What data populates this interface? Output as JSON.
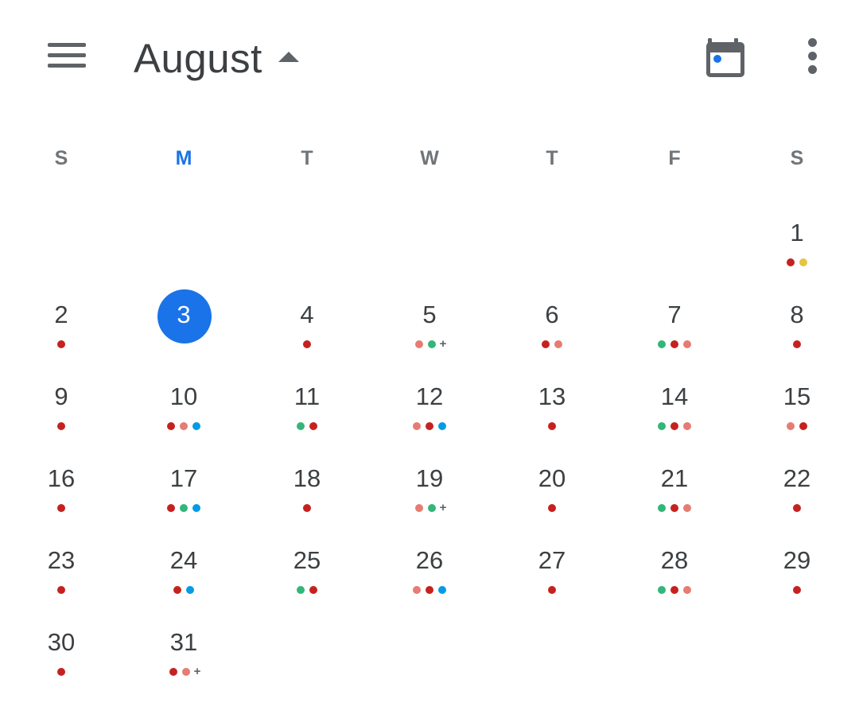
{
  "header": {
    "menu_icon": "hamburger-menu-icon",
    "month_title": "August",
    "toggle_icon": "caret-up-icon",
    "today_icon": "calendar-today-icon",
    "more_icon": "more-vert-icon"
  },
  "weekdays": [
    "S",
    "M",
    "T",
    "W",
    "T",
    "F",
    "S"
  ],
  "today": 3,
  "colors": {
    "red": "#c5221f",
    "salmon": "#e67c73",
    "green": "#33b679",
    "blue": "#039be5",
    "yellow": "#e4c441",
    "today_accent": "#1a73e8"
  },
  "days": [
    {
      "num": "1",
      "dots": [
        "red",
        "yellow"
      ]
    },
    {
      "num": "2",
      "dots": [
        "red"
      ]
    },
    {
      "num": "3",
      "dots": []
    },
    {
      "num": "4",
      "dots": [
        "red"
      ]
    },
    {
      "num": "5",
      "dots": [
        "salmon",
        "green"
      ],
      "plus": "+"
    },
    {
      "num": "6",
      "dots": [
        "red",
        "salmon"
      ]
    },
    {
      "num": "7",
      "dots": [
        "green",
        "red",
        "salmon"
      ]
    },
    {
      "num": "8",
      "dots": [
        "red"
      ]
    },
    {
      "num": "9",
      "dots": [
        "red"
      ]
    },
    {
      "num": "10",
      "dots": [
        "red",
        "salmon",
        "blue"
      ]
    },
    {
      "num": "11",
      "dots": [
        "green",
        "red"
      ]
    },
    {
      "num": "12",
      "dots": [
        "salmon",
        "red",
        "blue"
      ]
    },
    {
      "num": "13",
      "dots": [
        "red"
      ]
    },
    {
      "num": "14",
      "dots": [
        "green",
        "red",
        "salmon"
      ]
    },
    {
      "num": "15",
      "dots": [
        "salmon",
        "red"
      ]
    },
    {
      "num": "16",
      "dots": [
        "red"
      ]
    },
    {
      "num": "17",
      "dots": [
        "red",
        "green",
        "blue"
      ]
    },
    {
      "num": "18",
      "dots": [
        "red"
      ]
    },
    {
      "num": "19",
      "dots": [
        "salmon",
        "green"
      ],
      "plus": "+"
    },
    {
      "num": "20",
      "dots": [
        "red"
      ]
    },
    {
      "num": "21",
      "dots": [
        "green",
        "red",
        "salmon"
      ]
    },
    {
      "num": "22",
      "dots": [
        "red"
      ]
    },
    {
      "num": "23",
      "dots": [
        "red"
      ]
    },
    {
      "num": "24",
      "dots": [
        "red",
        "blue"
      ]
    },
    {
      "num": "25",
      "dots": [
        "green",
        "red"
      ]
    },
    {
      "num": "26",
      "dots": [
        "salmon",
        "red",
        "blue"
      ]
    },
    {
      "num": "27",
      "dots": [
        "red"
      ]
    },
    {
      "num": "28",
      "dots": [
        "green",
        "red",
        "salmon"
      ]
    },
    {
      "num": "29",
      "dots": [
        "red"
      ]
    },
    {
      "num": "30",
      "dots": [
        "red"
      ]
    },
    {
      "num": "31",
      "dots": [
        "red",
        "salmon"
      ],
      "plus": "+"
    }
  ]
}
